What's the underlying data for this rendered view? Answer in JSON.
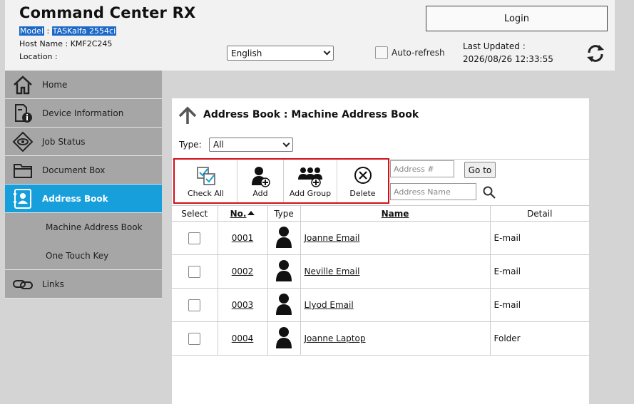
{
  "header": {
    "title": "Command Center RX",
    "model_label": "Model",
    "model_value": "TASKalfa 2554ci",
    "host_label": "Host Name : ",
    "host_value": "KMF2C245",
    "location_label": "Location :",
    "login_label": "Login",
    "language": "English",
    "auto_refresh_label": "Auto-refresh",
    "last_updated_label": "Last Updated :",
    "last_updated_value": "2026/08/26 12:33:55"
  },
  "sidebar": {
    "items": [
      {
        "label": "Home",
        "icon": "home-icon"
      },
      {
        "label": "Device Information",
        "icon": "device-info-icon"
      },
      {
        "label": "Job Status",
        "icon": "job-status-icon"
      },
      {
        "label": "Document Box",
        "icon": "folder-icon"
      },
      {
        "label": "Address Book",
        "icon": "address-book-icon"
      },
      {
        "label": "Links",
        "icon": "link-icon"
      }
    ],
    "sub_items": [
      {
        "label": "Machine Address Book"
      },
      {
        "label": "One Touch Key"
      }
    ]
  },
  "main": {
    "title": "Address Book : Machine Address Book",
    "type_label": "Type:",
    "type_value": "All",
    "toolbar": {
      "check_all": "Check All",
      "add": "Add",
      "add_group": "Add Group",
      "delete": "Delete"
    },
    "address_number_placeholder": "Address #",
    "goto_label": "Go to",
    "address_name_placeholder": "Address Name",
    "table": {
      "headers": {
        "select": "Select",
        "no": "No.",
        "type": "Type",
        "name": "Name",
        "detail": "Detail"
      },
      "rows": [
        {
          "no": "0001",
          "name": "Joanne Email",
          "detail": "E-mail"
        },
        {
          "no": "0002",
          "name": "Neville Email",
          "detail": "E-mail"
        },
        {
          "no": "0003",
          "name": "Llyod Email",
          "detail": "E-mail"
        },
        {
          "no": "0004",
          "name": "Joanne Laptop",
          "detail": "Folder"
        }
      ]
    }
  },
  "colors": {
    "accent": "#179fdc",
    "highlight": "#1c68c7",
    "toolbar_border": "#d3101a",
    "sidebar": "#a6a6a6"
  }
}
